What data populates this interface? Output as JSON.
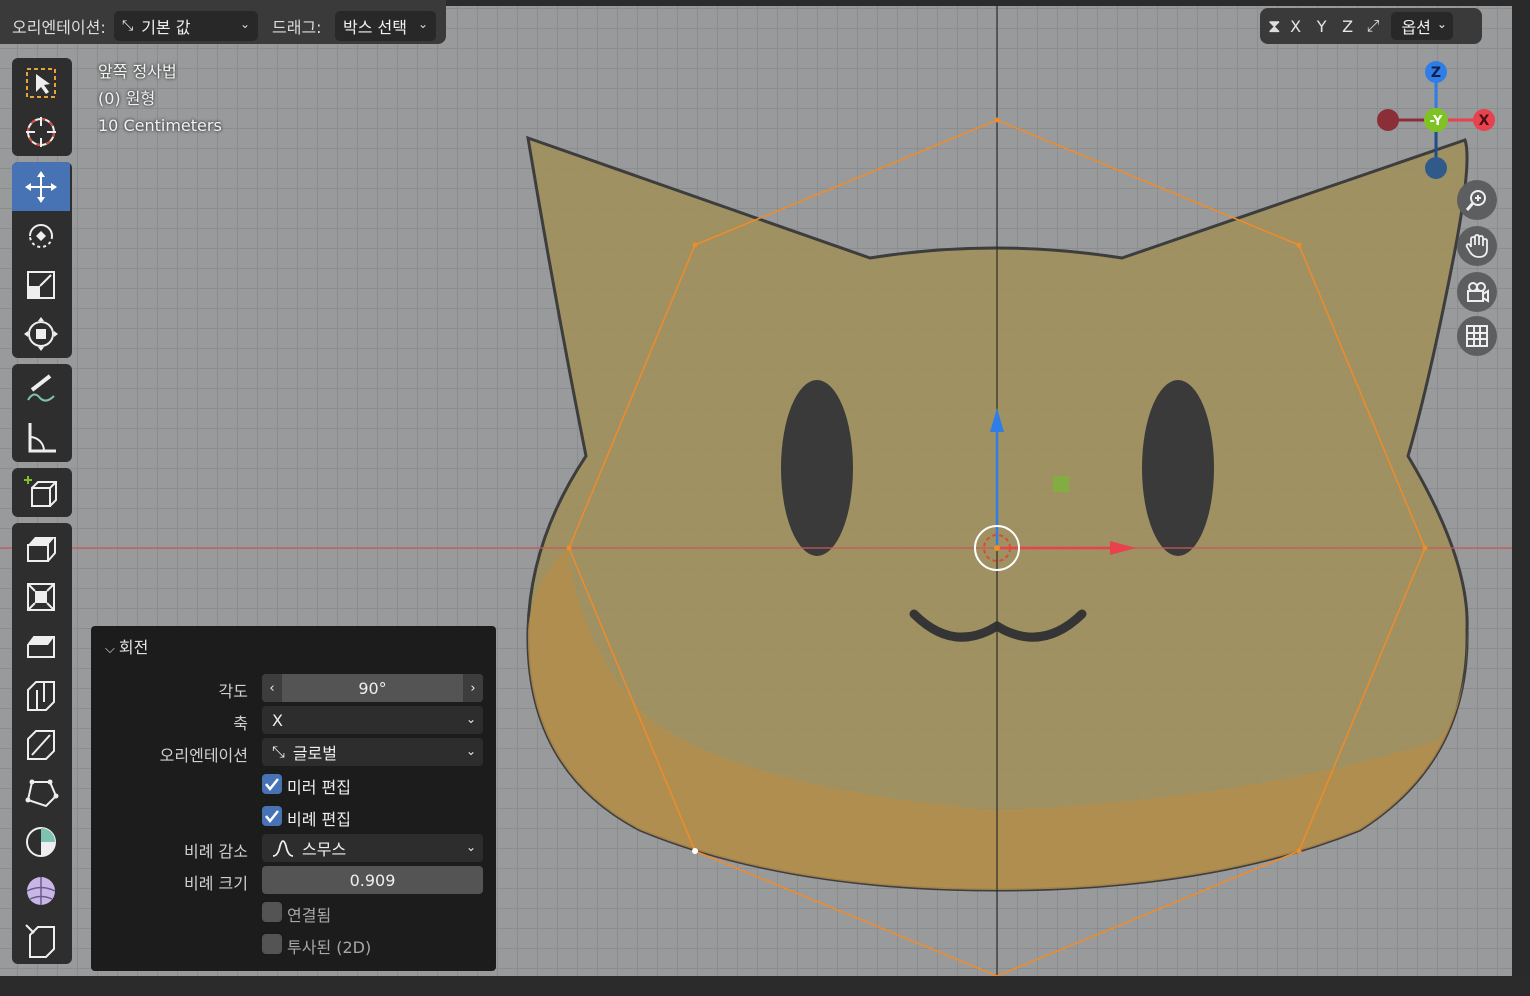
{
  "header": {
    "orientation_label": "오리엔테이션:",
    "orientation_value": "기본 값",
    "drag_label": "드래그:",
    "drag_value": "박스 선택",
    "axis_x": "X",
    "axis_y": "Y",
    "axis_z": "Z",
    "options_label": "옵션"
  },
  "viewport_info": {
    "view_name": "앞쪽 정사법",
    "object_name": "(0) 원형",
    "scale": "10 Centimeters"
  },
  "gizmo": {
    "z_label": "Z",
    "y_label": "-Y",
    "x_label": "X"
  },
  "toolbar": {
    "tools": [
      "select-box",
      "cursor",
      "move",
      "rotate",
      "scale",
      "transform",
      "annotate",
      "measure",
      "add-cube",
      "extrude",
      "inset",
      "bevel",
      "loop-cut",
      "knife",
      "poly-build",
      "spin",
      "smooth",
      "shrink-fatten"
    ],
    "active": "move"
  },
  "operator_panel": {
    "title": "회전",
    "angle_label": "각도",
    "angle_value": "90°",
    "axis_label": "축",
    "axis_value": "X",
    "orientation_label": "오리엔테이션",
    "orientation_value": "글로벌",
    "mirror_edit": {
      "label": "미러 편집",
      "checked": true
    },
    "proportional_edit": {
      "label": "비례 편집",
      "checked": true
    },
    "falloff_label": "비례 감소",
    "falloff_value": "스무스",
    "size_label": "비례 크기",
    "size_value": "0.909",
    "connected": {
      "label": "연결됨",
      "checked": false
    },
    "projected": {
      "label": "투사된 (2D)",
      "checked": false
    }
  },
  "colors": {
    "active_tool": "#4772b3",
    "face_fill": "#a38f55",
    "outline_orange": "#f08b2a",
    "x_axis": "#e8424f",
    "y_axis": "#7ec224",
    "z_axis": "#2f7ee8"
  }
}
